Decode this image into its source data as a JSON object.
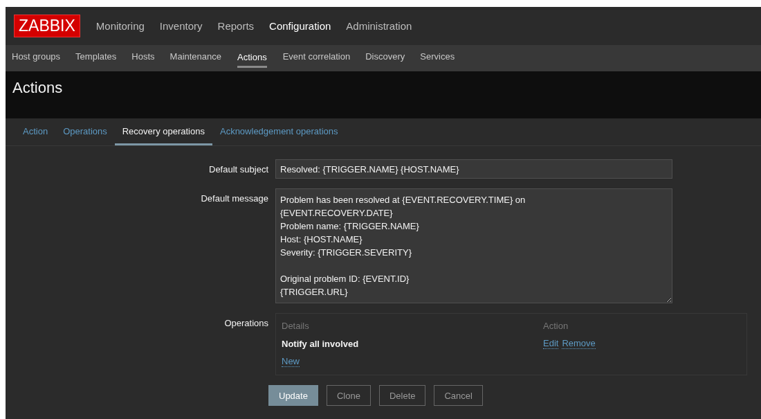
{
  "logo": "ZABBIX",
  "main_menu": [
    {
      "label": "Monitoring",
      "selected": false
    },
    {
      "label": "Inventory",
      "selected": false
    },
    {
      "label": "Reports",
      "selected": false
    },
    {
      "label": "Configuration",
      "selected": true
    },
    {
      "label": "Administration",
      "selected": false
    }
  ],
  "sub_menu": [
    {
      "label": "Host groups",
      "selected": false
    },
    {
      "label": "Templates",
      "selected": false
    },
    {
      "label": "Hosts",
      "selected": false
    },
    {
      "label": "Maintenance",
      "selected": false
    },
    {
      "label": "Actions",
      "selected": true
    },
    {
      "label": "Event correlation",
      "selected": false
    },
    {
      "label": "Discovery",
      "selected": false
    },
    {
      "label": "Services",
      "selected": false
    }
  ],
  "page_title": "Actions",
  "tabs": [
    {
      "label": "Action",
      "selected": false
    },
    {
      "label": "Operations",
      "selected": false
    },
    {
      "label": "Recovery operations",
      "selected": true
    },
    {
      "label": "Acknowledgement operations",
      "selected": false
    }
  ],
  "form": {
    "default_subject": {
      "label": "Default subject",
      "value": "Resolved: {TRIGGER.NAME} {HOST.NAME}"
    },
    "default_message": {
      "label": "Default message",
      "value": "Problem has been resolved at {EVENT.RECOVERY.TIME} on\n{EVENT.RECOVERY.DATE}\nProblem name: {TRIGGER.NAME}\nHost: {HOST.NAME}\nSeverity: {TRIGGER.SEVERITY}\n\nOriginal problem ID: {EVENT.ID}\n{TRIGGER.URL}"
    },
    "operations": {
      "label": "Operations",
      "columns": [
        "Details",
        "Action"
      ],
      "rows": [
        {
          "details": "Notify all involved",
          "actions": [
            "Edit",
            "Remove"
          ]
        }
      ],
      "new_link": "New"
    }
  },
  "buttons": [
    {
      "label": "Update",
      "kind": "primary"
    },
    {
      "label": "Clone",
      "kind": "secondary"
    },
    {
      "label": "Delete",
      "kind": "secondary"
    },
    {
      "label": "Cancel",
      "kind": "secondary"
    }
  ]
}
